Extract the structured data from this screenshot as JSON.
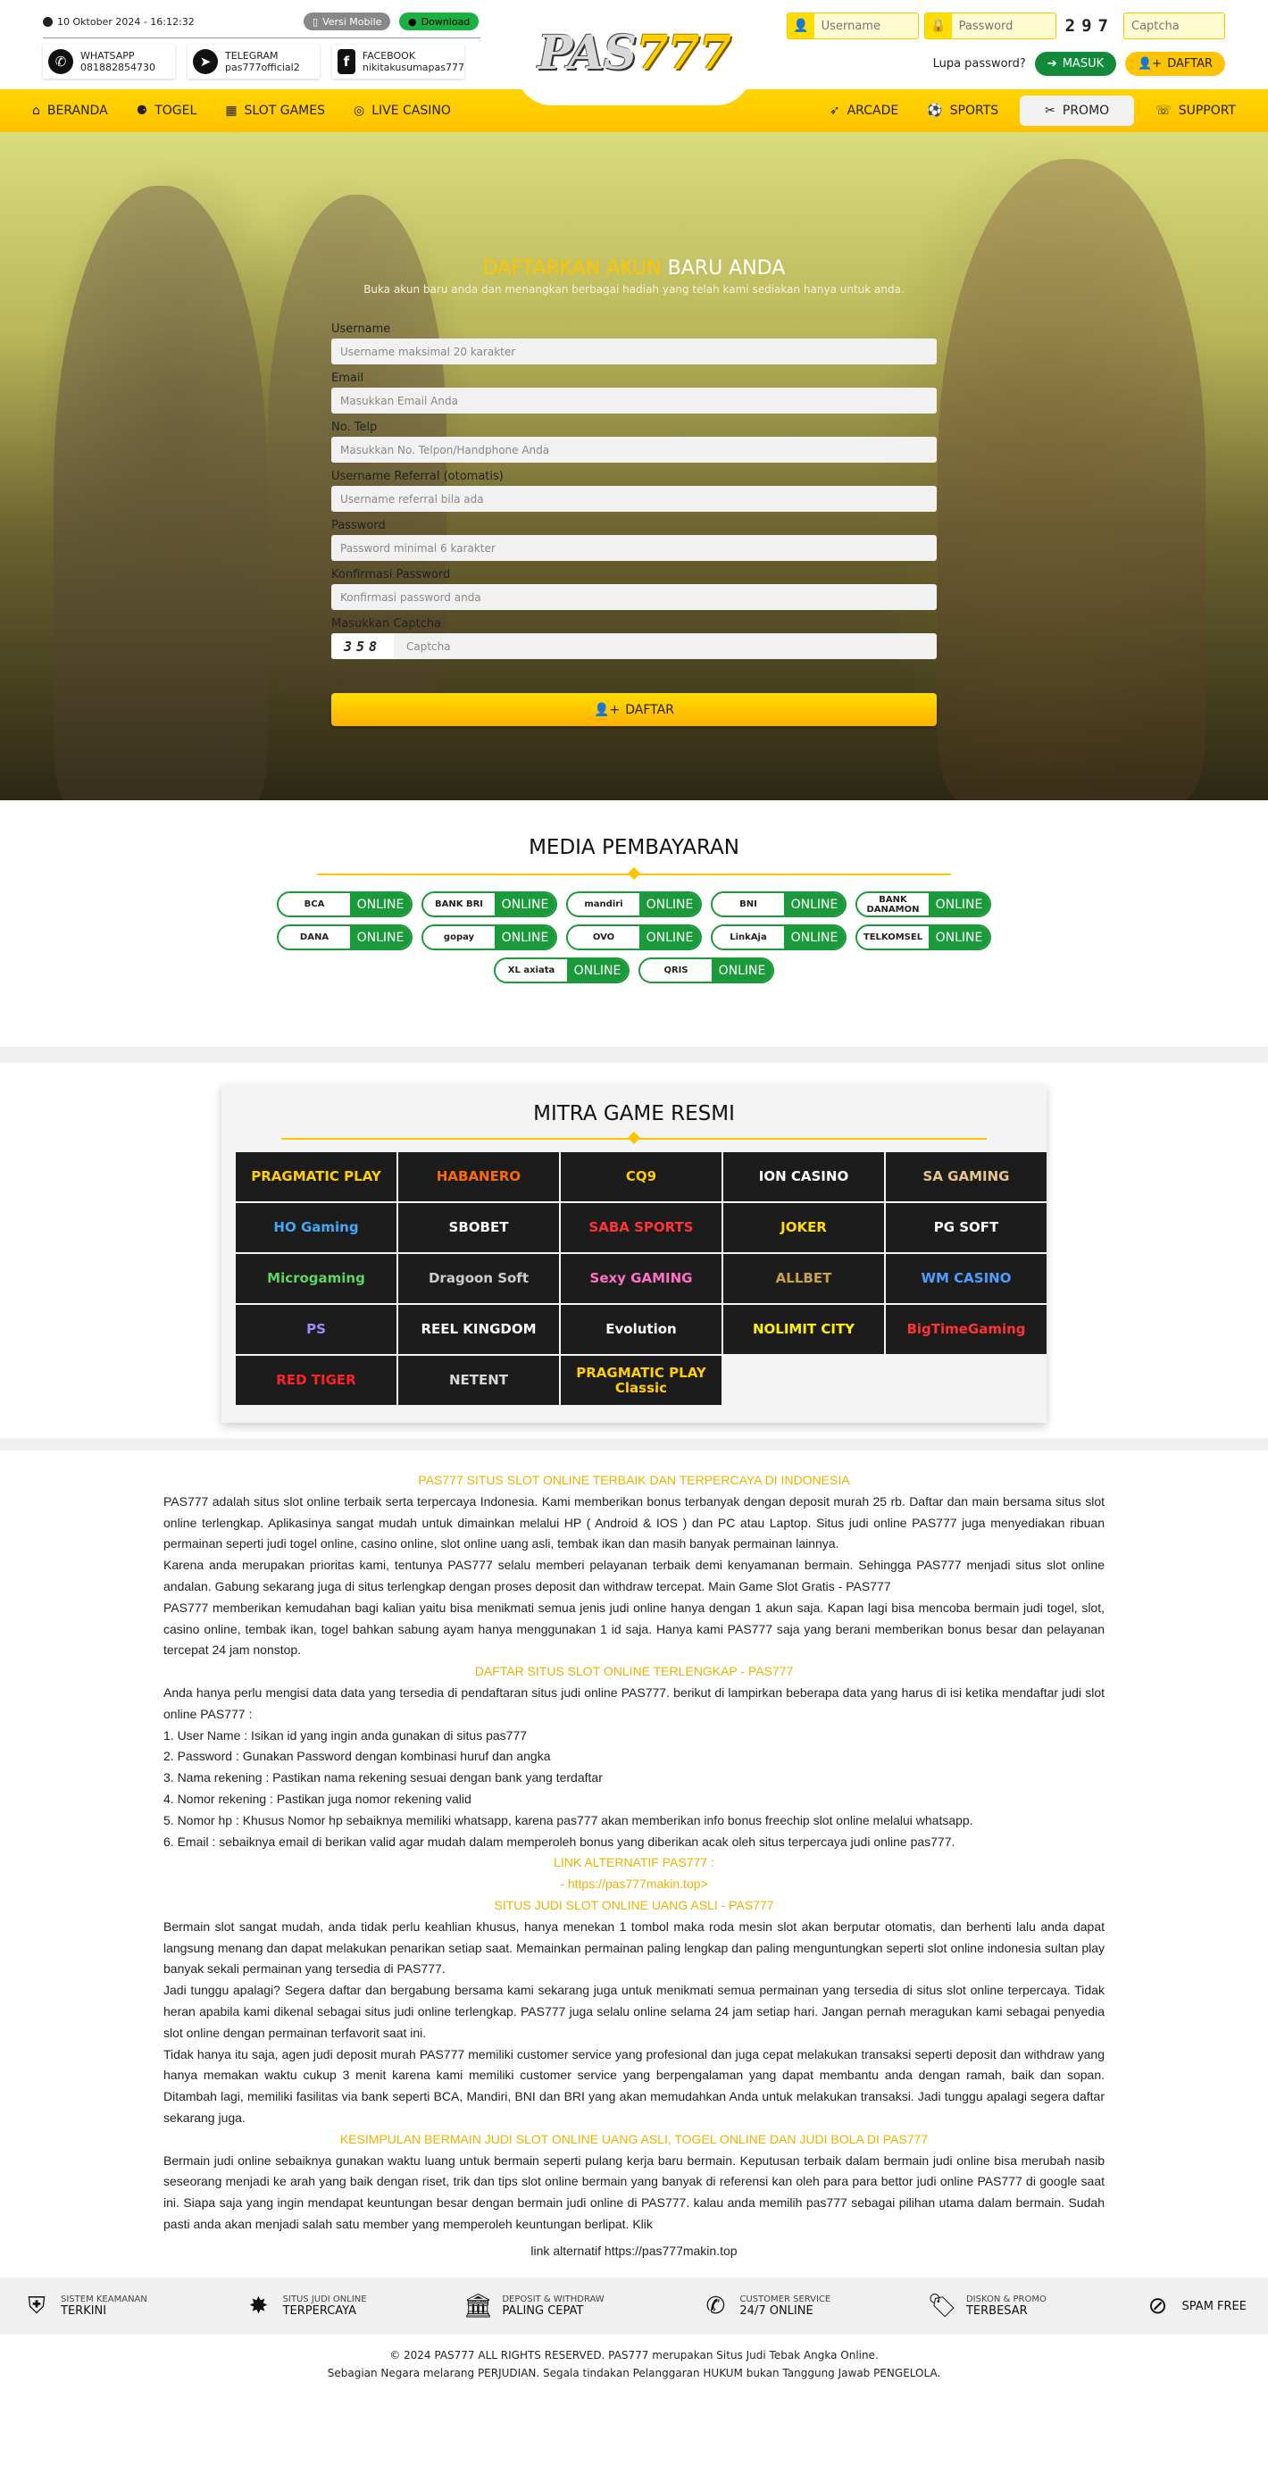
{
  "header": {
    "date": "10 Oktober 2024 - 16:12:32",
    "mobile_label": "Versi Mobile",
    "download_label": "Download",
    "contacts": [
      {
        "label": "WHATSAPP",
        "value": "081882854730",
        "icon": "whatsapp-icon"
      },
      {
        "label": "TELEGRAM",
        "value": "pas777official2",
        "icon": "telegram-icon"
      },
      {
        "label": "FACEBOOK",
        "value": "nikitakusumapas777",
        "icon": "facebook-icon"
      }
    ],
    "logo_text": "PAS",
    "logo_num": "777",
    "login": {
      "username_placeholder": "Username",
      "password_placeholder": "Password",
      "captcha_code": "297",
      "captcha_placeholder": "Captcha",
      "forgot": "Lupa password?",
      "masuk": "MASUK",
      "daftar": "DAFTAR"
    }
  },
  "nav": {
    "left": [
      "BERANDA",
      "TOGEL",
      "SLOT GAMES",
      "LIVE CASINO"
    ],
    "right": [
      "ARCADE",
      "SPORTS",
      "PROMO",
      "SUPPORT"
    ]
  },
  "register": {
    "title_hl": "DAFTARKAN AKUN",
    "title_rest": " BARU ANDA",
    "subtitle": "Buka akun baru anda dan menangkan berbagai hadiah yang telah kami sediakan hanya untuk anda.",
    "fields": [
      {
        "label": "Username",
        "placeholder": "Username maksimal 20 karakter"
      },
      {
        "label": "Email",
        "placeholder": "Masukkan Email Anda"
      },
      {
        "label": "No. Telp",
        "placeholder": "Masukkan No. Telpon/Handphone Anda"
      },
      {
        "label": "Username Referral (otomatis)",
        "placeholder": "Username referral bila ada"
      },
      {
        "label": "Password",
        "placeholder": "Password minimal 6 karakter"
      },
      {
        "label": "Konfirmasi Password",
        "placeholder": "Konfirmasi password anda"
      }
    ],
    "captcha_label": "Masukkan Captcha",
    "captcha_code": "358",
    "captcha_placeholder": "Captcha",
    "submit": "DAFTAR"
  },
  "payment": {
    "title": "MEDIA PEMBAYARAN",
    "status": "ONLINE",
    "banks": [
      "BCA",
      "BANK BRI",
      "mandiri",
      "BNI",
      "BANK DANAMON",
      "DANA",
      "gopay",
      "OVO",
      "LinkAja",
      "TELKOMSEL",
      "XL axiata",
      "QRIS"
    ]
  },
  "partners": {
    "title": "MITRA GAME RESMI",
    "items": [
      "PRAGMATIC PLAY",
      "HABANERO",
      "CQ9",
      "ION CASINO",
      "SA GAMING",
      "HO Gaming",
      "SBOBET",
      "SABA SPORTS",
      "JOKER",
      "PG SOFT",
      "Microgaming",
      "Dragoon Soft",
      "Sexy GAMING",
      "ALLBET",
      "WM CASINO",
      "PS",
      "REEL KINGDOM",
      "Evolution",
      "NOLIMIT CITY",
      "BigTimeGaming",
      "RED TIGER",
      "NETENT",
      "PRAGMATIC PLAY Classic"
    ]
  },
  "seo": {
    "h1": "PAS777 SITUS SLOT ONLINE TERBAIK DAN TERPERCAYA DI INDONESIA",
    "p1": "PAS777 adalah situs slot online terbaik serta terpercaya Indonesia. Kami memberikan bonus terbanyak dengan deposit murah 25 rb. Daftar dan main bersama situs slot online terlengkap. Aplikasinya sangat mudah untuk dimainkan melalui HP ( Android & IOS ) dan PC atau Laptop. Situs judi online PAS777 juga menyediakan ribuan permainan seperti judi togel online, casino online, slot online uang asli, tembak ikan dan masih banyak permainan lainnya.",
    "p2": "Karena anda merupakan prioritas kami, tentunya PAS777 selalu memberi pelayanan terbaik demi kenyamanan bermain. Sehingga PAS777 menjadi situs slot online andalan. Gabung sekarang juga di situs terlengkap dengan proses deposit dan withdraw tercepat. Main Game Slot Gratis - PAS777",
    "p3": "PAS777 memberikan kemudahan bagi kalian yaitu bisa menikmati semua jenis judi online hanya dengan 1 akun saja. Kapan lagi bisa mencoba bermain judi togel, slot, casino online, tembak ikan, togel bahkan sabung ayam hanya menggunakan 1 id saja. Hanya kami PAS777 saja yang berani memberikan bonus besar dan pelayanan tercepat 24 jam nonstop.",
    "h2": "DAFTAR SITUS SLOT ONLINE TERLENGKAP - PAS777",
    "p4": "Anda hanya perlu mengisi data data yang tersedia di pendaftaran situs judi online PAS777. berikut di lampirkan beberapa data yang harus di isi ketika mendaftar judi slot online PAS777 :",
    "list": [
      "1. User Name : Isikan id yang ingin anda gunakan di situs pas777",
      "2. Password : Gunakan Password dengan kombinasi huruf dan angka",
      "3. Nama rekening : Pastikan nama rekening sesuai dengan bank yang terdaftar",
      "4. Nomor rekening : Pastikan juga nomor rekening valid",
      "5. Nomor hp : Khusus Nomor hp sebaiknya memiliki whatsapp, karena pas777 akan memberikan info bonus freechip slot online melalui whatsapp.",
      "6. Email : sebaiknya email di berikan valid agar mudah dalam memperoleh bonus yang diberikan acak oleh situs terpercaya judi online pas777."
    ],
    "link_title": "LINK ALTERNATIF PAS777 :",
    "link_value": "- https://pas777makin.top>",
    "h3": "SITUS JUDI SLOT ONLINE UANG ASLI - PAS777",
    "p5": "Bermain slot sangat mudah, anda tidak perlu keahlian khusus, hanya menekan 1 tombol maka roda mesin slot akan berputar otomatis, dan berhenti lalu anda dapat langsung menang dan dapat melakukan penarikan setiap saat. Memainkan permainan paling lengkap dan paling menguntungkan seperti slot online indonesia sultan play banyak sekali permainan yang tersedia di PAS777.",
    "p6": "Jadi tunggu apalagi? Segera daftar dan bergabung bersama kami sekarang juga untuk menikmati semua permainan yang tersedia di situs slot online terpercaya. Tidak heran apabila kami dikenal sebagai situs judi online terlengkap. PAS777 juga selalu online selama 24 jam setiap hari. Jangan pernah meragukan kami sebagai penyedia slot online dengan permainan terfavorit saat ini.",
    "p7": "Tidak hanya itu saja, agen judi deposit murah PAS777 memiliki customer service yang profesional dan juga cepat melakukan transaksi seperti deposit dan withdraw yang hanya memakan waktu cukup 3 menit karena kami memiliki customer service yang berpengalaman yang dapat membantu anda dengan ramah, baik dan sopan. Ditambah lagi, memiliki fasilitas via bank seperti BCA, Mandiri, BNI dan BRI yang akan memudahkan Anda untuk melakukan transaksi. Jadi tunggu apalagi segera daftar sekarang juga.",
    "h4": "KESIMPULAN BERMAIN JUDI SLOT ONLINE UANG ASLI, TOGEL ONLINE DAN JUDI BOLA DI PAS777",
    "p8": "Bermain judi online sebaiknya gunakan waktu luang untuk bermain seperti pulang kerja baru bermain. Keputusan terbaik dalam bermain judi online bisa merubah nasib seseorang menjadi ke arah yang baik dengan riset, trik dan tips slot online bermain yang banyak di referensi kan oleh para para bettor judi online PAS777 di google saat ini. Siapa saja yang ingin mendapat keuntungan besar dengan bermain judi online di PAS777. kalau anda memilih pas777 sebagai pilihan utama dalam bermain. Sudah pasti anda akan menjadi salah satu member yang memperoleh keuntungan berlipat. Klik",
    "alt_link": "link alternatif https://pas777makin.top"
  },
  "features": [
    {
      "t1": "SISTEM KEAMANAN",
      "t2": "TERKINI",
      "icon": "shield-icon"
    },
    {
      "t1": "SITUS JUDI ONLINE",
      "t2": "TERPERCAYA",
      "icon": "badge-icon"
    },
    {
      "t1": "DEPOSIT & WITHDRAW",
      "t2": "PALING CEPAT",
      "icon": "bank-icon"
    },
    {
      "t1": "CUSTOMER SERVICE",
      "t2": "24/7 ONLINE",
      "icon": "phone-icon"
    },
    {
      "t1": "DISKON & PROMO",
      "t2": "TERBESAR",
      "icon": "tag-icon"
    },
    {
      "t1": "",
      "t2": "SPAM FREE",
      "icon": "no-spam-icon"
    }
  ],
  "footer": {
    "line1": "© 2024 PAS777 ALL RIGHTS RESERVED. PAS777 merupakan Situs Judi Tebak Angka Online.",
    "line2": "Sebagian Negara melarang PERJUDIAN. Segala tindakan Pelanggaran HUKUM bukan Tanggung Jawab PENGELOLA."
  }
}
